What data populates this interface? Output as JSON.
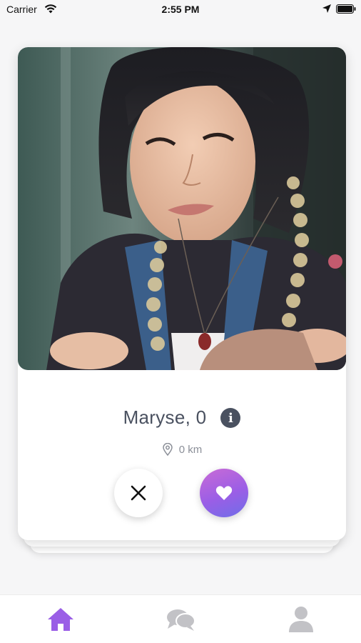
{
  "status_bar": {
    "carrier": "Carrier",
    "time": "2:55 PM",
    "icons": [
      "wifi-icon",
      "location-arrow-icon",
      "battery-icon"
    ]
  },
  "card": {
    "photo": "profile-photo",
    "name_age": "Maryse, 0",
    "distance": "0 km",
    "info_icon": "info-icon"
  },
  "actions": {
    "dislike_icon": "close-icon",
    "like_icon": "heart-icon"
  },
  "tab_bar": {
    "tabs": [
      {
        "icon": "home-icon",
        "active": true
      },
      {
        "icon": "chat-bubbles-icon",
        "active": false
      },
      {
        "icon": "user-icon",
        "active": false
      }
    ]
  },
  "colors": {
    "accent_start": "#c96bd6",
    "accent_end": "#6f6ee8",
    "active_tab": "#9a5ee6",
    "inactive_tab": "#c2c2c6",
    "text_primary": "#4a5160",
    "text_secondary": "#8b8f98"
  }
}
